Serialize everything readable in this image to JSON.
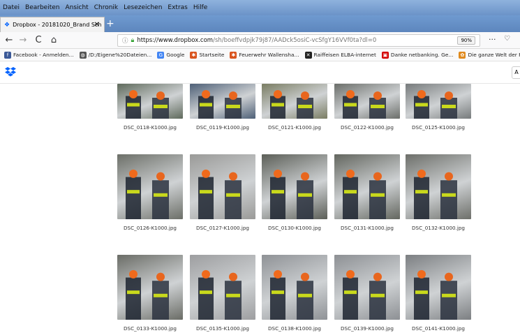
{
  "menu": {
    "items": [
      "Datei",
      "Bearbeiten",
      "Ansicht",
      "Chronik",
      "Lesezeichen",
      "Extras",
      "Hilfe"
    ]
  },
  "tab": {
    "title": "Dropbox - 20181020_Brand Sch",
    "close": "✕",
    "new": "+"
  },
  "nav": {
    "back": "←",
    "forward": "→",
    "reload": "C",
    "home": "⌂",
    "url_host": "https://www.dropbox.com",
    "url_path": "/sh/boeffvdpjk79j87/AADck5osiC-vcSfgY16VVf0ta?dl=0",
    "zoom": "90%",
    "more": "···"
  },
  "bookmarks": [
    {
      "label": "Facebook - Anmelden...",
      "icon": "facebook-icon",
      "color": "#3b5998",
      "glyph": "f"
    },
    {
      "label": "/D:/Eigene%20Dateien...",
      "icon": "globe-icon",
      "color": "#555",
      "glyph": "◍"
    },
    {
      "label": "Google",
      "icon": "google-icon",
      "color": "#4285f4",
      "glyph": "G"
    },
    {
      "label": "Startseite",
      "icon": "ff-logo-icon",
      "color": "#d9541e",
      "glyph": "✱"
    },
    {
      "label": "Feuerwehr Wallensha...",
      "icon": "ff-logo-icon",
      "color": "#d9541e",
      "glyph": "✱"
    },
    {
      "label": "Raiffeisen ELBA-internet",
      "icon": "raiffeisen-icon",
      "color": "#222",
      "glyph": "✕"
    },
    {
      "label": "Danke netbanking. Ge...",
      "icon": "gift-icon",
      "color": "#d40000",
      "glyph": "▣"
    },
    {
      "label": "Die ganze Welt der Fe...",
      "icon": "wine-icon",
      "color": "#e08a1e",
      "glyph": "✿"
    }
  ],
  "header": {
    "right_button": "A"
  },
  "files": [
    {
      "name": "DSC_0118-K1000.jpg",
      "bg": "#5f6a5c"
    },
    {
      "name": "DSC_0119-K1000.jpg",
      "bg": "#4e6077"
    },
    {
      "name": "DSC_0121-K1000.jpg",
      "bg": "#7a7d63"
    },
    {
      "name": "DSC_0122-K1000.jpg",
      "bg": "#6b6e6a"
    },
    {
      "name": "DSC_0125-K1000.jpg",
      "bg": "#777b7c"
    },
    {
      "name": "DSC_0126-K1000.jpg",
      "bg": "#6c6f68"
    },
    {
      "name": "DSC_0127-K1000.jpg",
      "bg": "#9a9a98"
    },
    {
      "name": "DSC_0130-K1000.jpg",
      "bg": "#5c5f58"
    },
    {
      "name": "DSC_0131-K1000.jpg",
      "bg": "#63665f"
    },
    {
      "name": "DSC_0132-K1000.jpg",
      "bg": "#6d6f6a"
    },
    {
      "name": "DSC_0133-K1000.jpg",
      "bg": "#6a6c66"
    },
    {
      "name": "DSC_0135-K1000.jpg",
      "bg": "#9d9ea0"
    },
    {
      "name": "DSC_0138-K1000.jpg",
      "bg": "#8f9296"
    },
    {
      "name": "DSC_0139-K1000.jpg",
      "bg": "#8d9094"
    },
    {
      "name": "DSC_0141-K1000.jpg",
      "bg": "#7c7f82"
    }
  ]
}
